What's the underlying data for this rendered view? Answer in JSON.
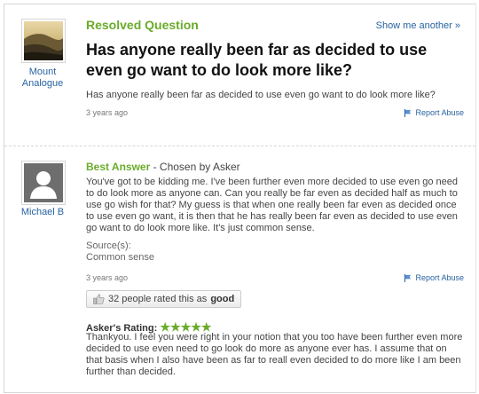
{
  "question": {
    "status": "Resolved Question",
    "show_another": "Show me another »",
    "title": "Has anyone really been far as decided to use even go want to do look more like?",
    "detail": "Has anyone really been far as decided to use even go want to do look more like?",
    "time": "3 years ago",
    "report": "Report Abuse",
    "asker": {
      "name": "Mount Analogue",
      "avatar_icon": "landscape-avatar-icon"
    }
  },
  "answer": {
    "label": "Best Answer",
    "chosen_by": " - Chosen by Asker",
    "answerer": {
      "name": "Michael B",
      "avatar_icon": "default-user-avatar-icon"
    },
    "body": "You've got to be kidding me. I've been further even more decided to use even go need to do look more as anyone can. Can you really be far even as decided half as much to use go wish for that? My guess is that when one really been far even as decided once to use even go want, it is then that he has really been far even as decided to use even go want to do look more like. It's just common sense.",
    "sources_label": "Source(s):",
    "source": "Common sense",
    "time": "3 years ago",
    "report": "Report Abuse",
    "rating_prefix": "32 people rated this as ",
    "rating_value": "good",
    "asker_rating_label": "Asker's Rating:",
    "stars": "★★★★★",
    "star_count": 5,
    "asker_comment": "Thankyou. I feel you were right in your notion that you too have been further even more decided to use even need to go look do more as anyone ever has. I assume that on that basis when I also have been as far to reall even decided to do more like I am been further than decided."
  },
  "colors": {
    "accent_green": "#6aab2b",
    "link_blue": "#2963a1"
  }
}
